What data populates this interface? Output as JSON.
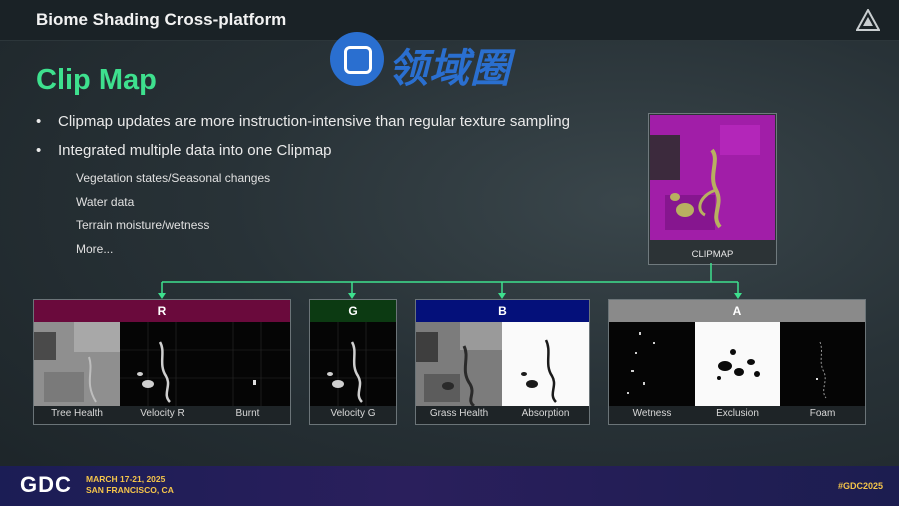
{
  "header": {
    "title": "Biome Shading Cross-platform",
    "logo_icon": "triangle-logo-icon"
  },
  "watermark": {
    "text": "领域圈"
  },
  "slide": {
    "heading": "Clip Map",
    "bullets": [
      "Clipmap updates are more instruction-intensive than regular texture sampling",
      "Integrated multiple data into one Clipmap"
    ],
    "sub_items": [
      "Vegetation states/Seasonal changes",
      "Water data",
      "Terrain moisture/wetness",
      "More..."
    ],
    "clipmap_label": "CLIPMAP"
  },
  "channels": [
    {
      "name": "R",
      "color": "#6a0a3c",
      "labels": [
        "Tree Health",
        "Velocity R",
        "Burnt"
      ]
    },
    {
      "name": "G",
      "color": "#0c3a12",
      "labels": [
        "Velocity G"
      ]
    },
    {
      "name": "B",
      "color": "#04107a",
      "labels": [
        "Grass Health",
        "Absorption"
      ]
    },
    {
      "name": "A",
      "color": "#8a8a8a",
      "labels": [
        "Wetness",
        "Exclusion",
        "Foam"
      ]
    }
  ],
  "footer": {
    "logo": "GDC",
    "date": "MARCH 17-21, 2025",
    "location": "SAN FRANCISCO, CA",
    "hashtag": "#GDC2025"
  },
  "colors": {
    "accent": "#3ee08e",
    "connector": "#3ee08e",
    "footer_bg": "#1b1d55",
    "footer_text": "#f5c54a"
  }
}
